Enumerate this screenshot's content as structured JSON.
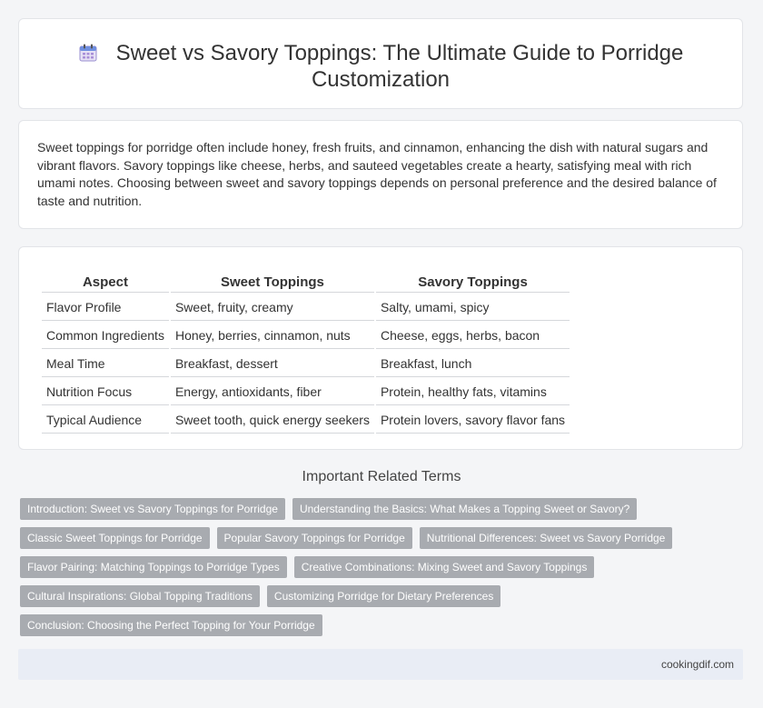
{
  "header": {
    "icon": "calendar-icon",
    "title": "Sweet vs Savory Toppings: The Ultimate Guide to Porridge Customization"
  },
  "intro": {
    "text": "Sweet toppings for porridge often include honey, fresh fruits, and cinnamon, enhancing the dish with natural sugars and vibrant flavors. Savory toppings like cheese, herbs, and sauteed vegetables create a hearty, satisfying meal with rich umami notes. Choosing between sweet and savory toppings depends on personal preference and the desired balance of taste and nutrition."
  },
  "table": {
    "headers": [
      "Aspect",
      "Sweet Toppings",
      "Savory Toppings"
    ],
    "rows": [
      [
        "Flavor Profile",
        "Sweet, fruity, creamy",
        "Salty, umami, spicy"
      ],
      [
        "Common Ingredients",
        "Honey, berries, cinnamon, nuts",
        "Cheese, eggs, herbs, bacon"
      ],
      [
        "Meal Time",
        "Breakfast, dessert",
        "Breakfast, lunch"
      ],
      [
        "Nutrition Focus",
        "Energy, antioxidants, fiber",
        "Protein, healthy fats, vitamins"
      ],
      [
        "Typical Audience",
        "Sweet tooth, quick energy seekers",
        "Protein lovers, savory flavor fans"
      ]
    ]
  },
  "related": {
    "title": "Important Related Terms",
    "tags": [
      "Introduction: Sweet vs Savory Toppings for Porridge",
      "Understanding the Basics: What Makes a Topping Sweet or Savory?",
      "Classic Sweet Toppings for Porridge",
      "Popular Savory Toppings for Porridge",
      "Nutritional Differences: Sweet vs Savory Porridge",
      "Flavor Pairing: Matching Toppings to Porridge Types",
      "Creative Combinations: Mixing Sweet and Savory Toppings",
      "Cultural Inspirations: Global Topping Traditions",
      "Customizing Porridge for Dietary Preferences",
      "Conclusion: Choosing the Perfect Topping for Your Porridge"
    ]
  },
  "footer": {
    "site": "cookingdif.com"
  }
}
